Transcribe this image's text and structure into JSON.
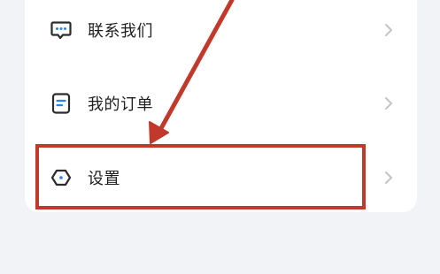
{
  "menu": {
    "items": [
      {
        "label": "联系我们",
        "icon": "chat-bubble-icon"
      },
      {
        "label": "我的订单",
        "icon": "order-list-icon"
      },
      {
        "label": "设置",
        "icon": "hexagon-settings-icon"
      }
    ]
  },
  "annotation": {
    "color": "#c0392b",
    "highlighted_item": "设置"
  }
}
